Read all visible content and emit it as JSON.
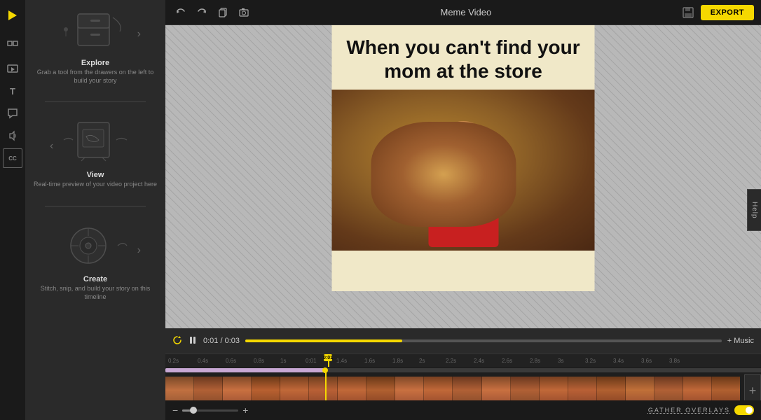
{
  "app": {
    "title": "Meme Video",
    "export_label": "EXPORT"
  },
  "topbar": {
    "undo_label": "↩",
    "redo_label": "↪",
    "copy_label": "⧉",
    "screenshot_label": "📷"
  },
  "sidebar": {
    "items": [
      {
        "id": "logo",
        "icon": "▶",
        "label": "logo"
      },
      {
        "id": "shapes",
        "icon": "⬜",
        "label": "shapes"
      },
      {
        "id": "media",
        "icon": "🎞",
        "label": "media"
      },
      {
        "id": "text",
        "icon": "T",
        "label": "text"
      },
      {
        "id": "comments",
        "icon": "💬",
        "label": "comments"
      },
      {
        "id": "audio",
        "icon": "♪",
        "label": "audio"
      },
      {
        "id": "captions",
        "icon": "CC",
        "label": "captions"
      }
    ]
  },
  "middle_panel": {
    "sections": [
      {
        "id": "explore",
        "title": "Explore",
        "description": "Grab a tool from the drawers on the left to build your story"
      },
      {
        "id": "view",
        "title": "View",
        "description": "Real-time preview of your video project here"
      },
      {
        "id": "create",
        "title": "Create",
        "description": "Stitch, snip, and build your story on this timeline"
      }
    ]
  },
  "canvas": {
    "meme_text": "When you can't find your mom at the store"
  },
  "playback": {
    "current_time": "0:01",
    "total_time": "0:03",
    "time_display": "0:01 / 0:03",
    "music_label": "+ Music",
    "progress_percent": 33
  },
  "timeline": {
    "ruler_ticks": [
      "0.2s",
      "0.4s",
      "0.6s",
      "0.8s",
      "1s",
      "0:01",
      "1.4s",
      "1.6s",
      "1.8s",
      "2s",
      "2.2s",
      "2.4s",
      "2.6s",
      "2.8s",
      "3s",
      "3.2s",
      "3.4s",
      "3.6s",
      "3.8s"
    ],
    "add_label": "+"
  },
  "zoom": {
    "gather_overlays_label": "GATHER OVERLAYS"
  },
  "help": {
    "label": "Help"
  }
}
